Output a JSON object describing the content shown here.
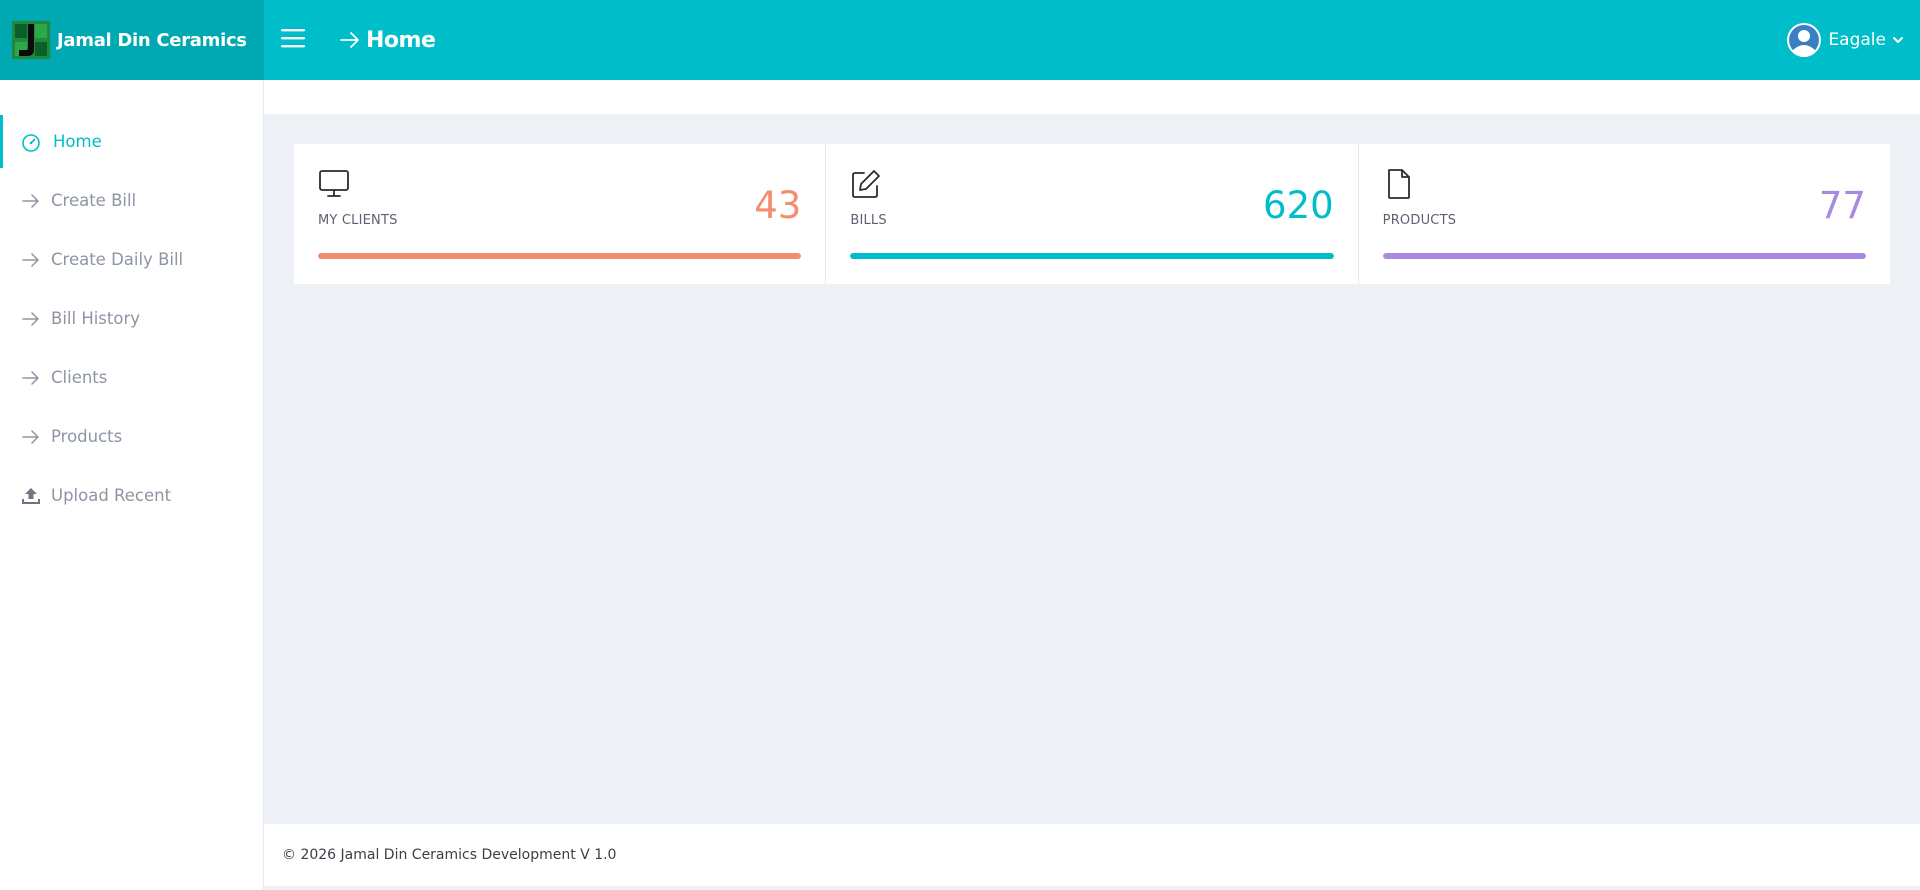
{
  "brand": {
    "name": "Jamal Din Ceramics"
  },
  "header": {
    "page_title": "Home"
  },
  "user": {
    "name": "Eagale"
  },
  "sidebar": {
    "items": [
      {
        "label": "Home",
        "icon": "dashboard-gauge-icon",
        "active": true
      },
      {
        "label": "Create Bill",
        "icon": "arrow-right-icon"
      },
      {
        "label": "Create Daily Bill",
        "icon": "arrow-right-icon"
      },
      {
        "label": "Bill History",
        "icon": "arrow-right-icon"
      },
      {
        "label": "Clients",
        "icon": "arrow-right-icon"
      },
      {
        "label": "Products",
        "icon": "arrow-right-icon"
      },
      {
        "label": "Upload Recent",
        "icon": "upload-icon"
      }
    ]
  },
  "stats": [
    {
      "label": "MY CLIENTS",
      "value": "43",
      "icon": "monitor-icon",
      "color": "#f48d6f",
      "progress": 1.0
    },
    {
      "label": "BILLS",
      "value": "620",
      "icon": "edit-icon",
      "color": "#00bec9",
      "progress": 1.0
    },
    {
      "label": "PRODUCTS",
      "value": "77",
      "icon": "file-icon",
      "color": "#a98ae0",
      "progress": 1.0
    }
  ],
  "footer": {
    "text": "© 2026 Jamal Din Ceramics Development V 1.0"
  },
  "colors": {
    "accent": "#00bec9",
    "brand_dark": "#00a9b2",
    "muted": "#8d95a3"
  }
}
